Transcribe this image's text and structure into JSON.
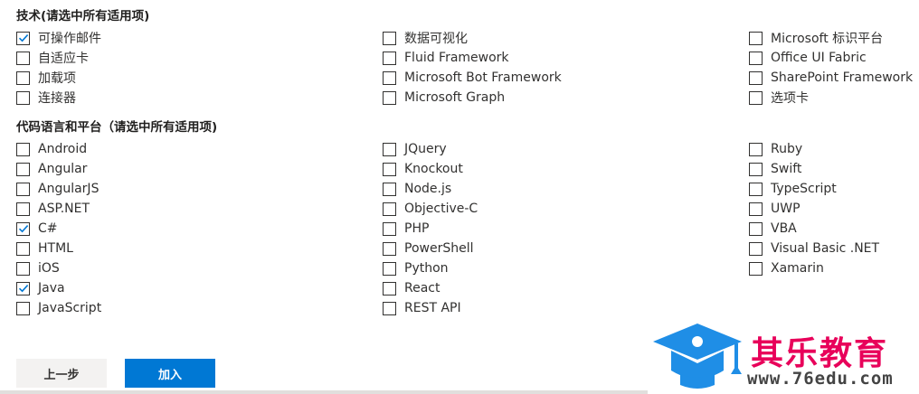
{
  "tech_section": {
    "title": "技术(请选中所有适用项)",
    "items": [
      {
        "label": "可操作邮件",
        "checked": true
      },
      {
        "label": "自适应卡",
        "checked": false
      },
      {
        "label": "加载项",
        "checked": false
      },
      {
        "label": "连接器",
        "checked": false
      },
      {
        "label": "数据可视化",
        "checked": false
      },
      {
        "label": "Fluid Framework",
        "checked": false
      },
      {
        "label": "Microsoft Bot Framework",
        "checked": false
      },
      {
        "label": "Microsoft Graph",
        "checked": false
      },
      {
        "label": "Microsoft 标识平台",
        "checked": false
      },
      {
        "label": "Office UI Fabric",
        "checked": false
      },
      {
        "label": "SharePoint Framework",
        "checked": false
      },
      {
        "label": "选项卡",
        "checked": false
      }
    ]
  },
  "lang_section": {
    "title": "代码语言和平台（请选中所有适用项)",
    "items": [
      {
        "label": "Android",
        "checked": false
      },
      {
        "label": "Angular",
        "checked": false
      },
      {
        "label": "AngularJS",
        "checked": false
      },
      {
        "label": "ASP.NET",
        "checked": false
      },
      {
        "label": "C#",
        "checked": true
      },
      {
        "label": "HTML",
        "checked": false
      },
      {
        "label": "iOS",
        "checked": false
      },
      {
        "label": "Java",
        "checked": true
      },
      {
        "label": "JavaScript",
        "checked": false
      },
      {
        "label": "JQuery",
        "checked": false
      },
      {
        "label": "Knockout",
        "checked": false
      },
      {
        "label": "Node.js",
        "checked": false
      },
      {
        "label": "Objective-C",
        "checked": false
      },
      {
        "label": "PHP",
        "checked": false
      },
      {
        "label": "PowerShell",
        "checked": false
      },
      {
        "label": "Python",
        "checked": false
      },
      {
        "label": "React",
        "checked": false
      },
      {
        "label": "REST API",
        "checked": false
      },
      {
        "label": "Ruby",
        "checked": false
      },
      {
        "label": "Swift",
        "checked": false
      },
      {
        "label": "TypeScript",
        "checked": false
      },
      {
        "label": "UWP",
        "checked": false
      },
      {
        "label": "VBA",
        "checked": false
      },
      {
        "label": "Visual Basic .NET",
        "checked": false
      },
      {
        "label": "Xamarin",
        "checked": false
      }
    ]
  },
  "buttons": {
    "prev_label": "上一步",
    "add_label": "加入"
  },
  "watermark": {
    "brand": "其乐教育",
    "url": "www.76edu.com"
  },
  "colors": {
    "accent": "#0078d4",
    "brand": "#e8005a",
    "logo_blue": "#1f8ee6"
  }
}
